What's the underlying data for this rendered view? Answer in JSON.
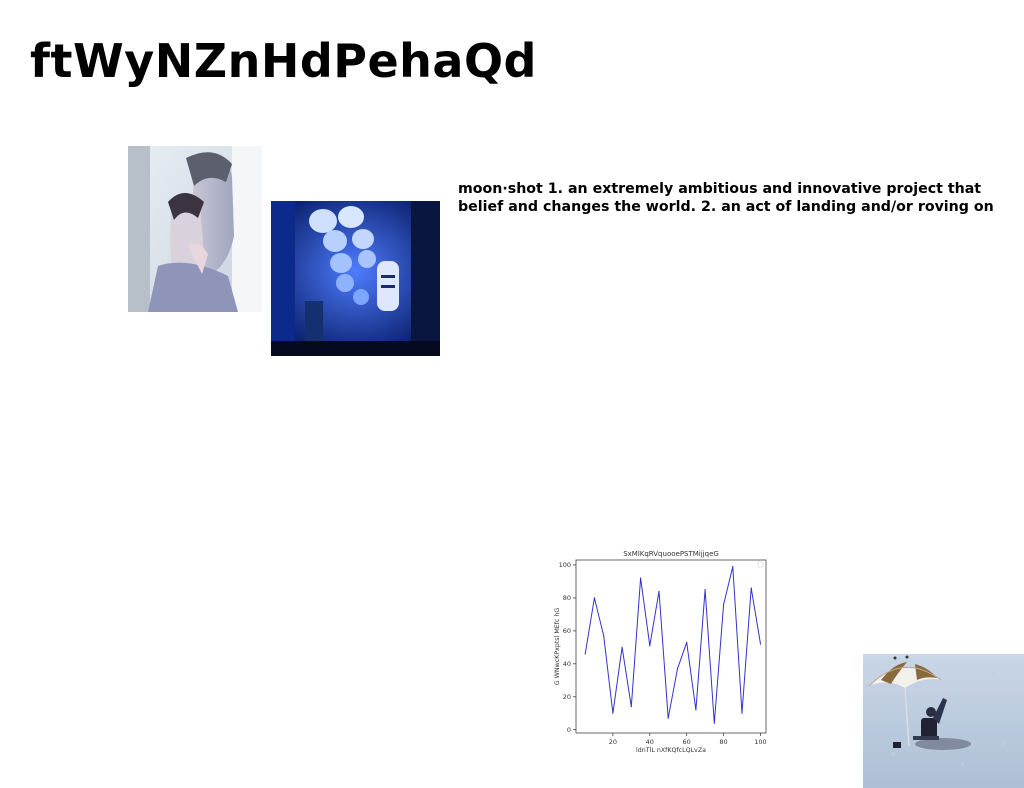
{
  "page": {
    "title": "ftWyNZnHdPehaQd",
    "definition_lines": [
      "moon·shot 1. an extremely ambitious and innovative project that",
      "belief and changes the world. 2. an act of landing and/or roving on"
    ]
  },
  "images": [
    {
      "name": "portrait-couple-photo",
      "subject": "two people, woman's face against man's cheek, pale blue tones"
    },
    {
      "name": "blue-lanterns-photo",
      "subject": "narrow alley with glowing blue paper lanterns"
    },
    {
      "name": "beach-umbrella-photo",
      "subject": "person sitting under striped umbrella on pale sand"
    }
  ],
  "chart_data": {
    "type": "line",
    "title": "SxMlKqRVquooePSTMijjqeG",
    "xlabel": "ldnTlL nXfKQfcLQLvZa",
    "ylabel": "G WNwcKPxptsl MEfc hG",
    "xlim": [
      0,
      103
    ],
    "ylim": [
      -2,
      103
    ],
    "xticks": [
      20,
      40,
      60,
      80,
      100
    ],
    "yticks": [
      0,
      20,
      40,
      60,
      80,
      100
    ],
    "color": "#3333cc",
    "grid": false,
    "series": [
      {
        "x": [
          5,
          10,
          15,
          20,
          25,
          30,
          35,
          40,
          45,
          50,
          55,
          60,
          65,
          70,
          75,
          80,
          85,
          90,
          95,
          100
        ],
        "values": [
          46,
          80,
          57,
          10,
          50,
          14,
          92,
          51,
          84,
          7,
          37,
          53,
          12,
          85,
          4,
          76,
          99,
          10,
          86,
          52
        ]
      }
    ]
  }
}
